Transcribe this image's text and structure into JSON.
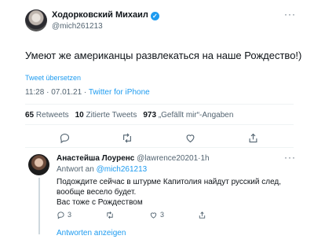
{
  "tweet": {
    "author_name": "Ходорковский Михаил",
    "author_handle": "@mich261213",
    "text": "Умеют же американцы развлекаться на наше Рождество!)",
    "translate_label": "Tweet übersetzen",
    "time": "11:28",
    "date": "07.01.21",
    "source": "Twitter for iPhone"
  },
  "stats": {
    "retweets_count": "65",
    "retweets_label": "Retweets",
    "quotes_count": "10",
    "quotes_label": "Zitierte Tweets",
    "likes_count": "973",
    "likes_label": "„Gefällt mir“-Angaben"
  },
  "reply": {
    "author_name": "Анастейша Лоуренс",
    "author_handle": "@lawrence20201",
    "time": "1h",
    "reply_to_label": "Antwort an",
    "reply_to_handle": "@mich261213",
    "lines": [
      "Подождите сейчас в штурме Капитолия найдут русский след,",
      "вообще весело будет.",
      "Вас тоже с Рождеством"
    ],
    "reply_count": "3",
    "like_count": "3"
  },
  "show_replies_label": "Antworten anzeigen",
  "colors": {
    "accent": "#1d9bf0",
    "secondary": "#536471",
    "divider": "#eff3f4"
  },
  "icons": [
    "verified-badge-icon",
    "more-icon",
    "reply-icon",
    "retweet-icon",
    "like-icon",
    "share-icon"
  ]
}
